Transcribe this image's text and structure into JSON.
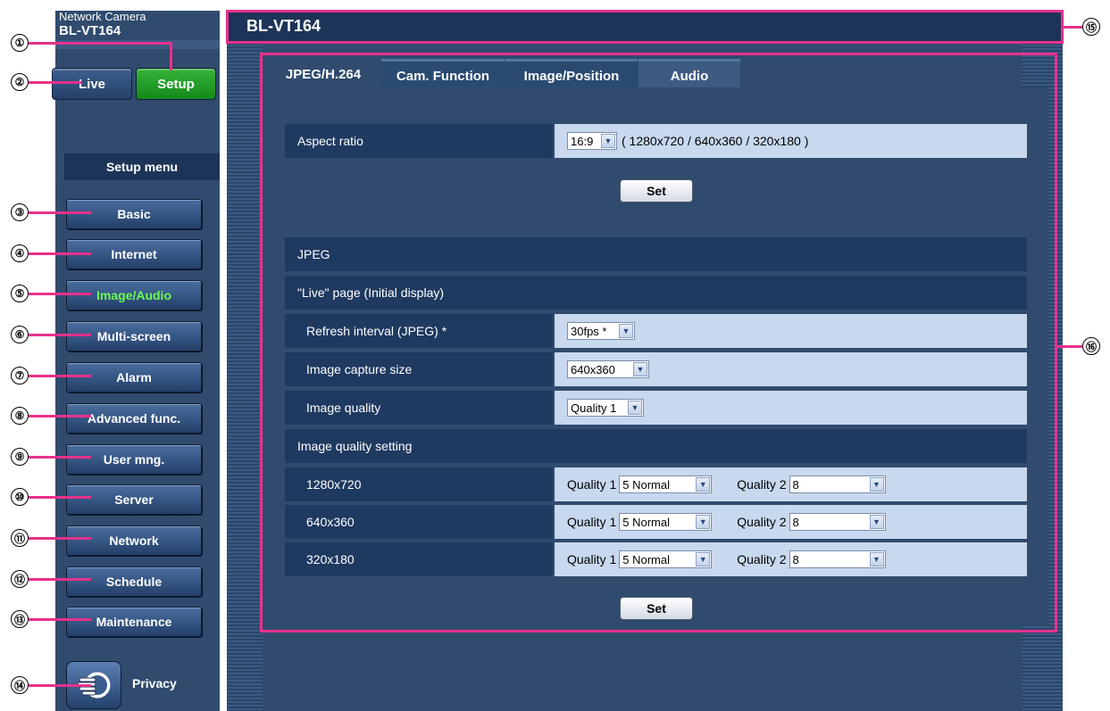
{
  "sidebar": {
    "brand_small": "Network Camera",
    "brand_model": "BL-VT164",
    "live_label": "Live",
    "setup_label": "Setup",
    "menu_header": "Setup menu",
    "items": [
      {
        "label": "Basic"
      },
      {
        "label": "Internet"
      },
      {
        "label": "Image/Audio"
      },
      {
        "label": "Multi-screen"
      },
      {
        "label": "Alarm"
      },
      {
        "label": "Advanced func."
      },
      {
        "label": "User mng."
      },
      {
        "label": "Server"
      },
      {
        "label": "Network"
      },
      {
        "label": "Schedule"
      },
      {
        "label": "Maintenance"
      }
    ],
    "privacy_label": "Privacy",
    "active_item": "Image/Audio"
  },
  "header": {
    "title": "BL-VT164"
  },
  "tabs": [
    {
      "label": "JPEG/H.264"
    },
    {
      "label": "Cam. Function"
    },
    {
      "label": "Image/Position"
    },
    {
      "label": "Audio"
    }
  ],
  "aspect": {
    "label": "Aspect ratio",
    "value": "16:9",
    "note": "( 1280x720 / 640x360 / 320x180 )",
    "set_label": "Set"
  },
  "jpeg": {
    "section_label": "JPEG",
    "live_page_label": "\"Live\" page (Initial display)",
    "refresh_label": "Refresh interval (JPEG) *",
    "refresh_value": "30fps *",
    "capture_label": "Image capture size",
    "capture_value": "640x360",
    "quality_label": "Image quality",
    "quality_value": "Quality 1",
    "quality_setting_label": "Image quality setting",
    "rows": [
      {
        "res": "1280x720",
        "q1_label": "Quality 1",
        "q1": "5 Normal",
        "q2_label": "Quality 2",
        "q2": "8"
      },
      {
        "res": "640x360",
        "q1_label": "Quality 1",
        "q1": "5 Normal",
        "q2_label": "Quality 2",
        "q2": "8"
      },
      {
        "res": "320x180",
        "q1_label": "Quality 1",
        "q1": "5 Normal",
        "q2_label": "Quality 2",
        "q2": "8"
      }
    ],
    "set_label": "Set"
  },
  "callouts": [
    "①",
    "②",
    "③",
    "④",
    "⑤",
    "⑥",
    "⑦",
    "⑧",
    "⑨",
    "⑩",
    "⑪",
    "⑫",
    "⑬",
    "⑭",
    "⑮",
    "⑯"
  ],
  "colors": {
    "accent_pink": "#e8318b",
    "active_green": "#6dfb55",
    "setup_green": "#1c9a22"
  }
}
